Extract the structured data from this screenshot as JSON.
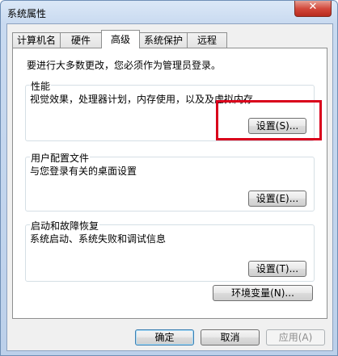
{
  "window": {
    "title": "系统属性",
    "close_label": "✕"
  },
  "tabs": [
    {
      "label": "计算机名",
      "active": false
    },
    {
      "label": "硬件",
      "active": false
    },
    {
      "label": "高级",
      "active": true
    },
    {
      "label": "系统保护",
      "active": false
    },
    {
      "label": "远程",
      "active": false
    }
  ],
  "advanced": {
    "admin_note": "要进行大多数更改，您必须作为管理员登录。",
    "performance": {
      "title": "性能",
      "description": "视觉效果，处理器计划，内存使用，以及及虚拟内存",
      "button": "设置(S)..."
    },
    "user_profiles": {
      "title": "用户配置文件",
      "description": "与您登录有关的桌面设置",
      "button": "设置(E)..."
    },
    "startup_recovery": {
      "title": "启动和故障恢复",
      "description": "系统启动、系统失败和调试信息",
      "button": "设置(T)..."
    },
    "env_button": "环境变量(N)..."
  },
  "footer": {
    "ok": "确定",
    "cancel": "取消",
    "apply": "应用(A)"
  },
  "highlight_color": "#d9001b"
}
